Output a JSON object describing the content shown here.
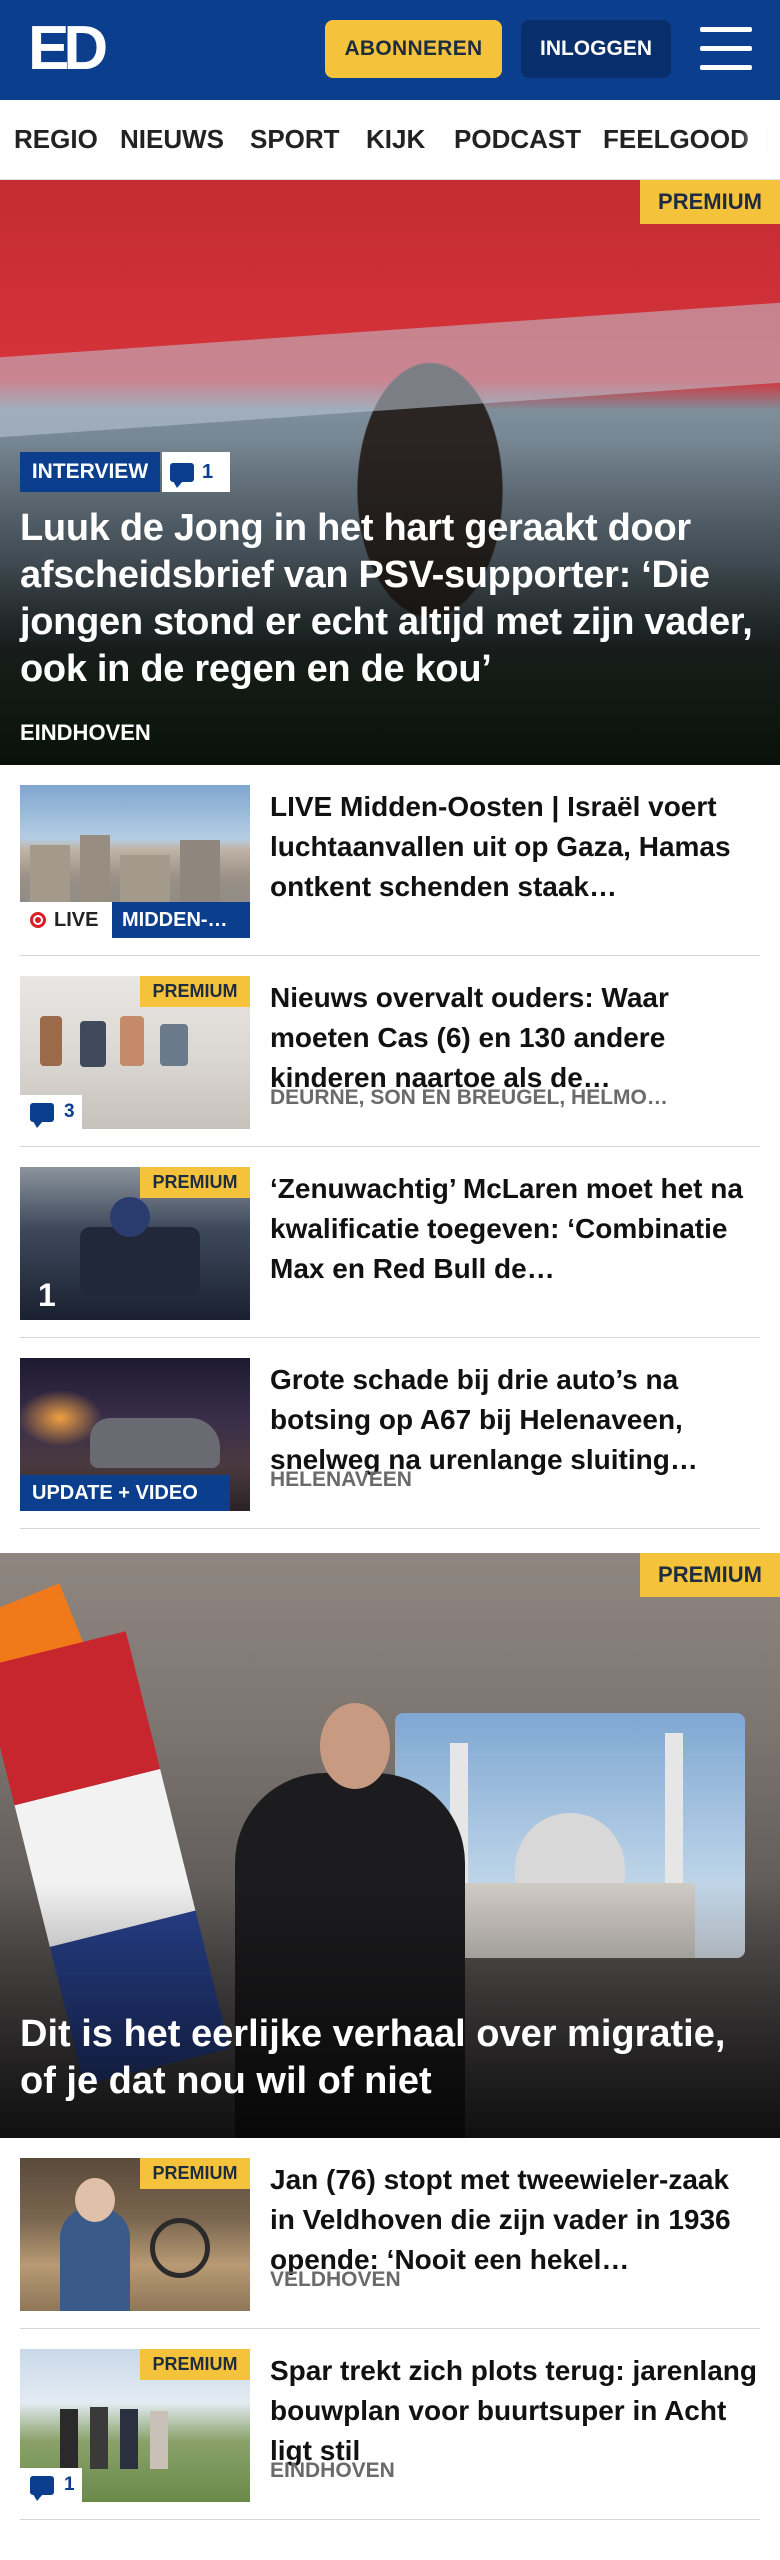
{
  "header": {
    "logo_text": "ED",
    "subscribe_label": "ABONNEREN",
    "login_label": "INLOGGEN",
    "menu_icon": "hamburger-menu-icon",
    "brand_color": "#0b3f8e",
    "accent_color": "#f5c33b"
  },
  "nav": {
    "items": [
      "REGIO",
      "NIEUWS",
      "SPORT",
      "KIJK",
      "PODCAST",
      "FEELGOOD"
    ]
  },
  "hero1": {
    "premium_label": "PREMIUM",
    "label": "INTERVIEW",
    "comments": "1",
    "title": "Luuk de Jong in het hart geraakt door afscheidsbrief van PSV-supporter: ‘Die jongen stond er echt altijd met zijn vader, ook in de regen en de kou’",
    "location": "EINDHOVEN"
  },
  "articles": [
    {
      "title": "LIVE Midden-Oosten | Israël voert luchtaanvallen uit op Gaza, Hamas ontkent schenden staak…",
      "live_label": "LIVE",
      "topic_label": "MIDDEN-…"
    },
    {
      "premium_label": "PREMIUM",
      "title": "Nieuws overvalt ouders: Waar moeten Cas (6) en 130 andere kinderen naartoe als de…",
      "location": "DEURNE, SON EN BREUGEL, HELMO…",
      "comments": "3"
    },
    {
      "premium_label": "PREMIUM",
      "title": "‘Zenuwachtig’ McLaren moet het na kwalificatie toegeven: ‘Combinatie Max en Red Bull de…"
    },
    {
      "title": "Grote schade bij drie auto’s na botsing op A67 bij Helenaveen, snelweg na urenlange sluiting…",
      "location": "HELENAVEEN",
      "update_label": "UPDATE + VIDEO"
    }
  ],
  "hero2": {
    "premium_label": "PREMIUM",
    "title": "Dit is het eerlijke verhaal over migratie, of je dat nou wil of niet"
  },
  "articles2": [
    {
      "premium_label": "PREMIUM",
      "title": "Jan (76) stopt met tweewieler-zaak in Veldhoven die zijn vader in 1936 opende: ‘Nooit een hekel…",
      "location": "VELDHOVEN"
    },
    {
      "premium_label": "PREMIUM",
      "title": "Spar trekt zich plots terug: jarenlang bouwplan voor buurtsuper in Acht ligt stil",
      "location": "EINDHOVEN",
      "comments": "1"
    }
  ]
}
